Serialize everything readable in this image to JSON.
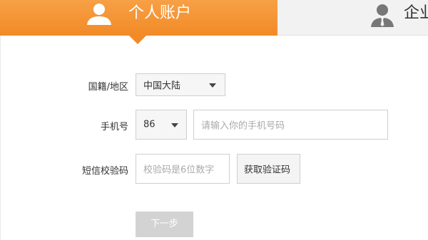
{
  "tabs": {
    "personal": {
      "label": "个人账户",
      "icon": "user-icon"
    },
    "enterprise": {
      "label": "企业",
      "icon": "business-user-icon"
    }
  },
  "form": {
    "region": {
      "label": "国籍/地区",
      "value": "中国大陆"
    },
    "phone": {
      "label": "手机号",
      "country_code": "86",
      "placeholder": "请输入你的手机号码"
    },
    "sms_code": {
      "label": "短信校验码",
      "placeholder": "校验码是6位数字",
      "button_label": "获取验证码"
    }
  },
  "next_button": {
    "label": "下一步"
  },
  "colors": {
    "accent": "#f28a26",
    "disabled_button": "#d3d3d3"
  }
}
